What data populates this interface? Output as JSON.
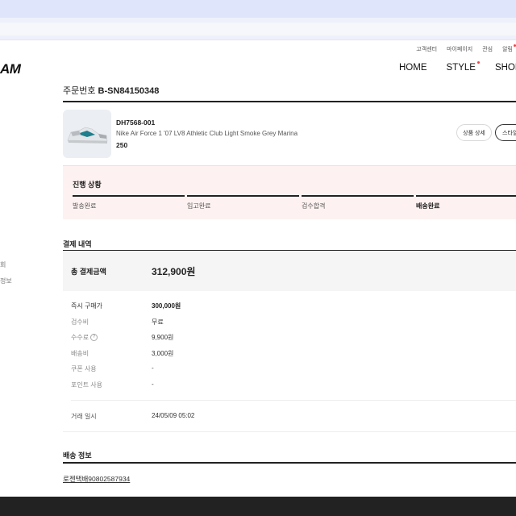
{
  "util_nav": [
    "고객센터",
    "마이페이지",
    "관심",
    "알림"
  ],
  "logo": "AM",
  "main_nav": [
    "HOME",
    "STYLE",
    "SHOP"
  ],
  "sidebar": {
    "item1": "회",
    "item2": "정보"
  },
  "order": {
    "label": "주문번호",
    "number": "B-SN84150348"
  },
  "product": {
    "sku": "DH7568-001",
    "name": "Nike Air Force 1 '07 LV8 Athletic Club Light Smoke Grey Marina",
    "size": "250",
    "detail_button": "상품 상세",
    "style_button": "스타일"
  },
  "progress": {
    "title": "진행 상황",
    "steps": [
      "발송완료",
      "입고완료",
      "검수합격",
      "배송완료"
    ],
    "current_index": 3
  },
  "payment": {
    "title": "결제 내역",
    "total_label": "총 결제금액",
    "total_value": "312,900원",
    "rows": [
      {
        "label": "즉시 구매가",
        "value": "300,000원"
      },
      {
        "label": "검수비",
        "value": "무료"
      },
      {
        "label": "수수료",
        "value": "9,900원"
      },
      {
        "label": "배송비",
        "value": "3,000원"
      },
      {
        "label": "쿠폰 사용",
        "value": "-"
      },
      {
        "label": "포인트 사용",
        "value": "-"
      }
    ],
    "qmark": "?",
    "trade_label": "거래 일시",
    "trade_value": "24/05/09 05:02"
  },
  "shipping": {
    "title": "배송 정보",
    "tracking": "로젠택배90802587934"
  },
  "colors": {
    "accent_red": "#ef4444",
    "progress_bg": "#fdf2f1",
    "shoe_teal": "#1f7f8c"
  }
}
